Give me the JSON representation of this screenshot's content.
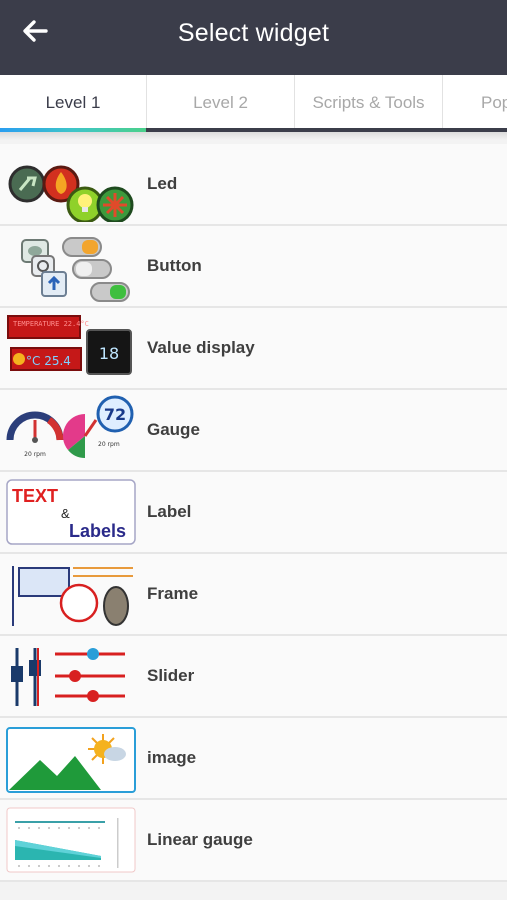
{
  "header": {
    "title": "Select widget",
    "back_icon": "arrow-left-icon"
  },
  "tabs": [
    {
      "label": "Level 1",
      "active": true
    },
    {
      "label": "Level 2",
      "active": false
    },
    {
      "label": "Scripts & Tools",
      "active": false
    },
    {
      "label": "Pop",
      "active": false
    }
  ],
  "colors": {
    "appbar": "#3b3d4a",
    "tab_indicator_start": "#2a9ef0",
    "tab_indicator_end": "#4bd08a"
  },
  "widgets": [
    {
      "label": "Led",
      "icon": "led-icon"
    },
    {
      "label": "Button",
      "icon": "button-icon"
    },
    {
      "label": "Value display",
      "icon": "value-display-icon",
      "thumb_texts": {
        "lcd_top": "TEMPERATURE 22.4°C",
        "lcd_bottom": "°C 25.4",
        "digital": "18"
      }
    },
    {
      "label": "Gauge",
      "icon": "gauge-icon",
      "thumb_texts": {
        "dial": "72",
        "rpm1": "20 rpm",
        "rpm2": "20 rpm"
      }
    },
    {
      "label": "Label",
      "icon": "label-icon",
      "thumb_texts": {
        "line1": "TEXT",
        "amp": "&",
        "line2": "Labels"
      }
    },
    {
      "label": "Frame",
      "icon": "frame-icon"
    },
    {
      "label": "Slider",
      "icon": "slider-icon"
    },
    {
      "label": "image",
      "icon": "image-icon"
    },
    {
      "label": "Linear gauge",
      "icon": "linear-gauge-icon"
    }
  ]
}
